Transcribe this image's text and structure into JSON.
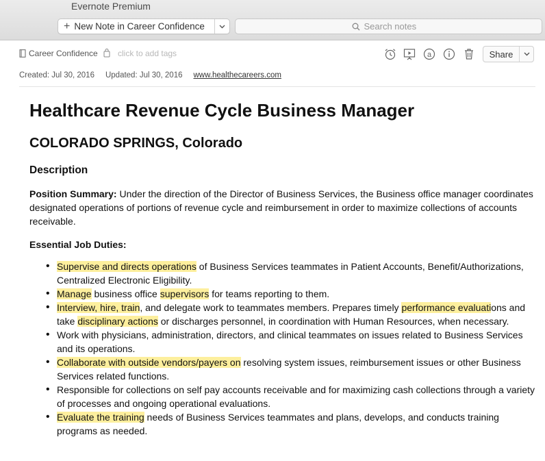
{
  "app": {
    "title": "Evernote Premium"
  },
  "toolbar": {
    "new_note_label": "New Note in Career Confidence",
    "search_placeholder": "Search notes"
  },
  "note_header": {
    "notebook": "Career Confidence",
    "tags_placeholder": "click to add tags",
    "share_label": "Share",
    "icons": [
      "reminder-icon",
      "presentation-icon",
      "info-icon",
      "delete-icon"
    ]
  },
  "meta": {
    "created": "Created: Jul 30, 2016",
    "updated": "Updated: Jul 30, 2016",
    "source_url": "www.healthecareers.com"
  },
  "note": {
    "title": "Healthcare Revenue Cycle Business Manager",
    "location": "COLORADO SPRINGS, Colorado",
    "section": "Description",
    "summary_label": "Position Summary:",
    "summary_text": " Under the direction of the Director of Business Services, the Business office manager coordinates designated operations of portions of revenue cycle and reimbursement in order to maximize collections of accounts receivable.",
    "duties_title": "Essential Job Duties:",
    "duties": [
      [
        {
          "t": "Supervise and directs operations",
          "h": true
        },
        {
          "t": " of Business Services teammates in Patient Accounts, Benefit/Authorizations, Centralized Electronic Eligibility.",
          "h": false
        }
      ],
      [
        {
          "t": "Manage",
          "h": true
        },
        {
          "t": " business office ",
          "h": false
        },
        {
          "t": "supervisors",
          "h": true
        },
        {
          "t": " for teams reporting to them.",
          "h": false
        }
      ],
      [
        {
          "t": "Interview, hire, train",
          "h": true
        },
        {
          "t": ", and delegate work to teammates members. Prepares timely ",
          "h": false
        },
        {
          "t": "performance evaluati",
          "h": true
        },
        {
          "t": "ons and take ",
          "h": false
        },
        {
          "t": "disciplinary actions",
          "h": true
        },
        {
          "t": " or discharges personnel, in coordination with Human Resources,  when necessary.",
          "h": false
        }
      ],
      [
        {
          "t": "Work with physicians, administration, directors, and clinical teammates on issues related to Business Services and its operations.",
          "h": false
        }
      ],
      [
        {
          "t": "Collaborate with outside vendors/payers on",
          "h": true
        },
        {
          "t": " resolving system issues, reimbursement issues or other Business Services related functions.",
          "h": false
        }
      ],
      [
        {
          "t": "Responsible for collections on self pay accounts receivable and for maximizing cash collections through a variety of processes and ongoing operational evaluations.",
          "h": false
        }
      ],
      [
        {
          "t": "Evaluate the training",
          "h": true
        },
        {
          "t": " needs of Business Services teammates and plans, develops, and conducts training programs as needed.",
          "h": false
        }
      ]
    ]
  },
  "colors": {
    "highlight": "#fdef9d",
    "toolbar_bg": "#e3e3e3"
  }
}
